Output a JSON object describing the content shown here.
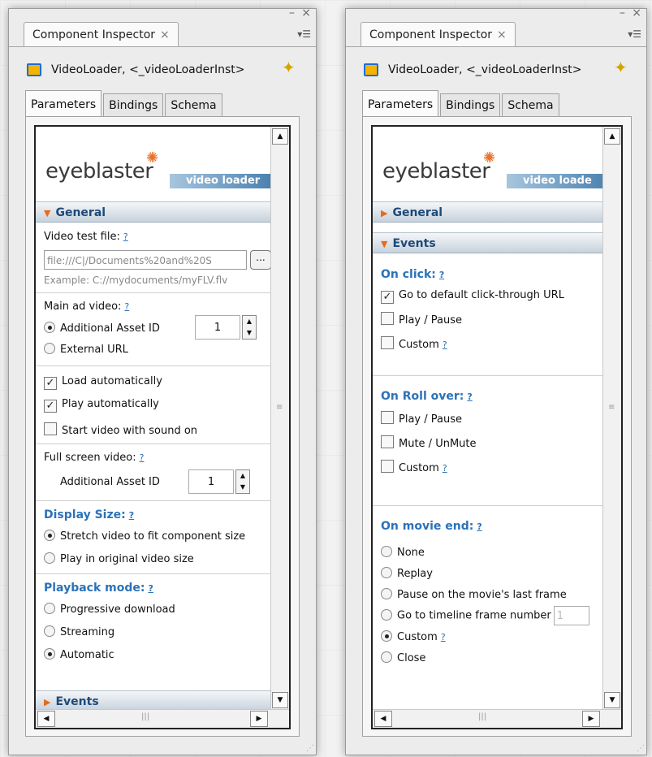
{
  "window_controls": {
    "minimize": "–",
    "close": "×",
    "menu": "▾☰"
  },
  "left_panel": {
    "title": "Component Inspector",
    "component_label": "VideoLoader, <_videoLoaderInst>",
    "tabs": [
      "Parameters",
      "Bindings",
      "Schema"
    ],
    "banner": {
      "logo": "eyeblaster",
      "subtitle": "video loader"
    },
    "general_section": "General",
    "video_test_file_label": "Video test file:",
    "video_test_file_value": "file:///C|/Documents%20and%20S",
    "browse_label": "...",
    "example_text": "Example: C://mydocuments/myFLV.flv",
    "main_ad_video_label": "Main ad video:",
    "additional_asset_id": "Additional Asset ID",
    "external_url": "External URL",
    "main_asset_value": "1",
    "load_automatically": "Load automatically",
    "play_automatically": "Play automatically",
    "start_with_sound": "Start video with sound on",
    "full_screen_label": "Full screen video:",
    "fullscreen_asset_label": "Additional Asset ID",
    "fullscreen_asset_value": "1",
    "display_size_heading": "Display Size:",
    "stretch_option": "Stretch video to fit component size",
    "original_size_option": "Play in original video size",
    "playback_heading": "Playback mode:",
    "progressive": "Progressive download",
    "streaming": "Streaming",
    "automatic": "Automatic",
    "events_section": "Events",
    "help": "?"
  },
  "right_panel": {
    "title": "Component Inspector",
    "component_label": "VideoLoader, <_videoLoaderInst>",
    "tabs": [
      "Parameters",
      "Bindings",
      "Schema"
    ],
    "banner": {
      "logo": "eyeblaster",
      "subtitle": "video loade"
    },
    "general_section": "General",
    "events_section": "Events",
    "on_click_heading": "On click:",
    "click_default": "Go to default click-through URL",
    "click_play_pause": "Play / Pause",
    "click_custom": "Custom",
    "on_rollover_heading": "On Roll over:",
    "roll_play_pause": "Play / Pause",
    "roll_mute": "Mute / UnMute",
    "roll_custom": "Custom",
    "on_movie_end_heading": "On movie end:",
    "end_none": "None",
    "end_replay": "Replay",
    "end_pause_last": "Pause on the movie's last frame",
    "end_goto_frame": "Go to timeline frame number",
    "end_goto_value": "1",
    "end_custom": "Custom",
    "end_close": "Close",
    "help": "?"
  },
  "state": {
    "main_ad_video": "Additional Asset ID",
    "load_automatically": true,
    "play_automatically": true,
    "start_with_sound": false,
    "display_size": "Stretch video to fit component size",
    "playback_mode": "Automatic",
    "on_click_default": true,
    "on_movie_end": "Custom"
  },
  "colors": {
    "accent": "#2b72b8",
    "section_arrow": "#e66b1a",
    "banner_blue": "#2f6ea3"
  }
}
